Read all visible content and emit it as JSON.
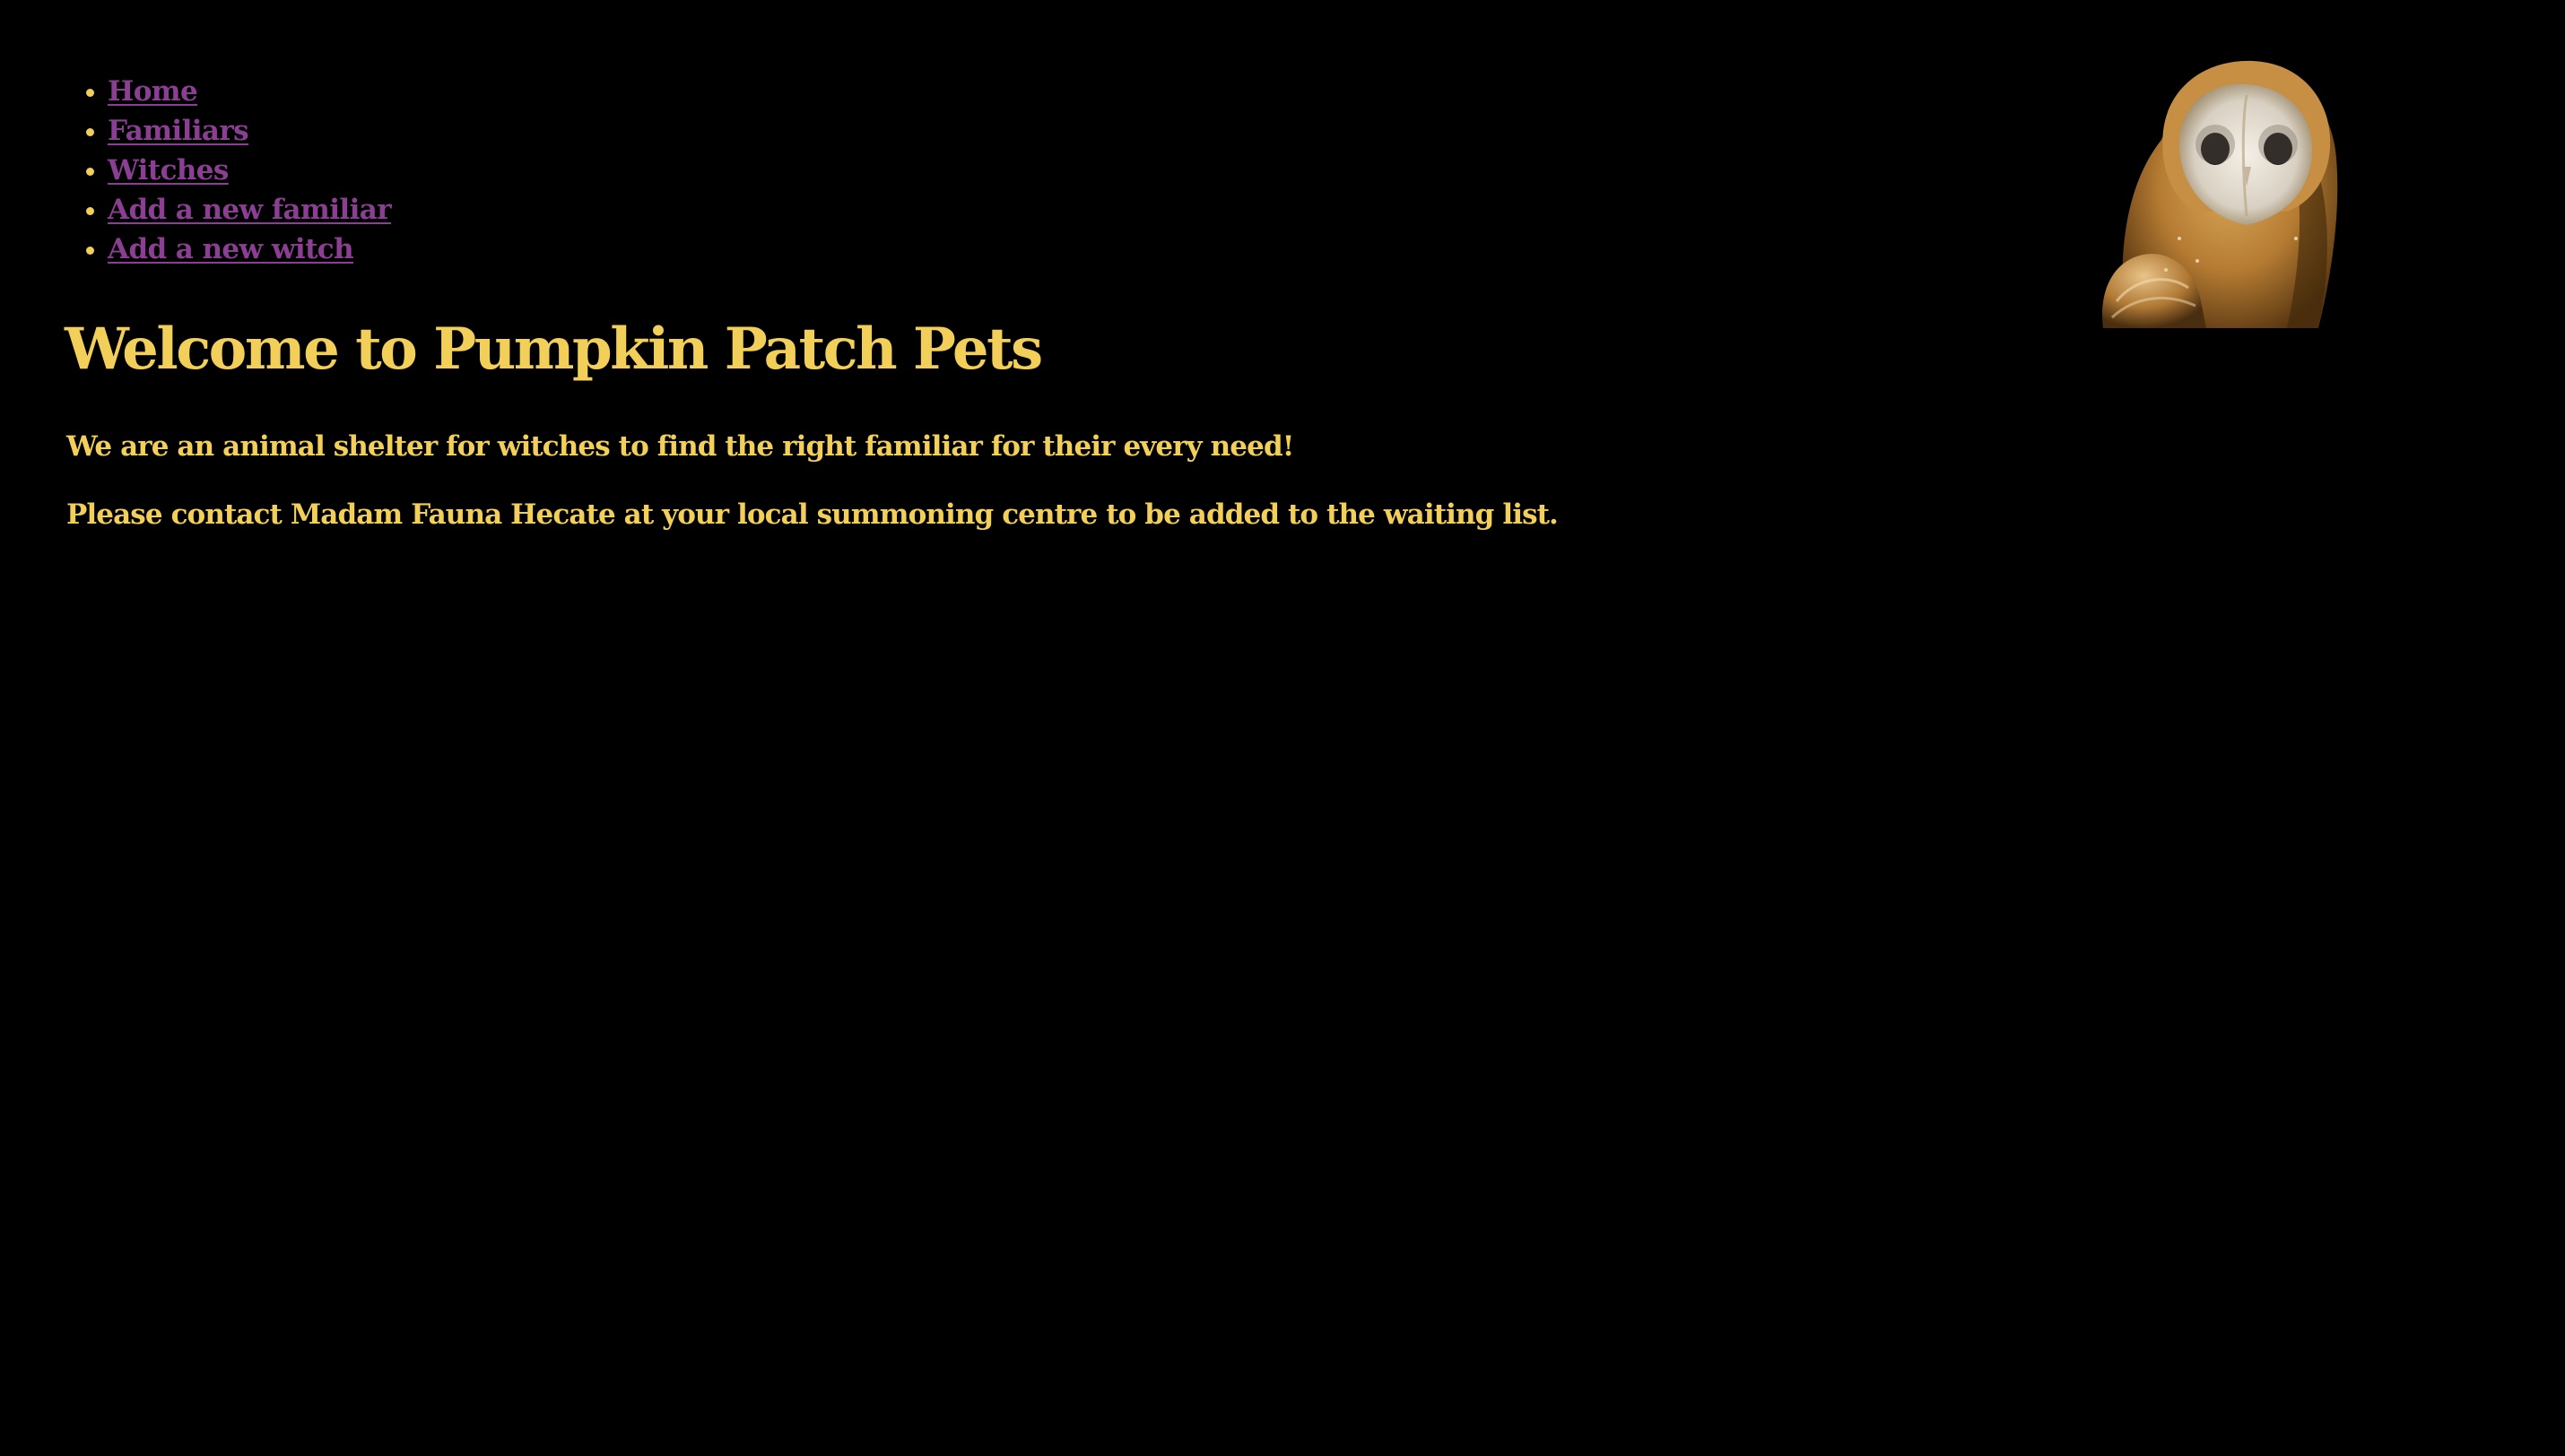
{
  "nav": {
    "items": [
      {
        "label": "Home"
      },
      {
        "label": "Familiars"
      },
      {
        "label": "Witches"
      },
      {
        "label": "Add a new familiar"
      },
      {
        "label": "Add a new witch"
      }
    ]
  },
  "main": {
    "title": "Welcome to Pumpkin Patch Pets",
    "paragraphs": [
      "We are an animal shelter for witches to find the right familiar for their every need!",
      "Please contact Madam Fauna Hecate at your local summoning centre to be added to the waiting list."
    ]
  },
  "header_image": {
    "icon": "barn-owl-image"
  },
  "colors": {
    "background": "#000000",
    "text": "#f2cf59",
    "link": "#8b3f93"
  }
}
